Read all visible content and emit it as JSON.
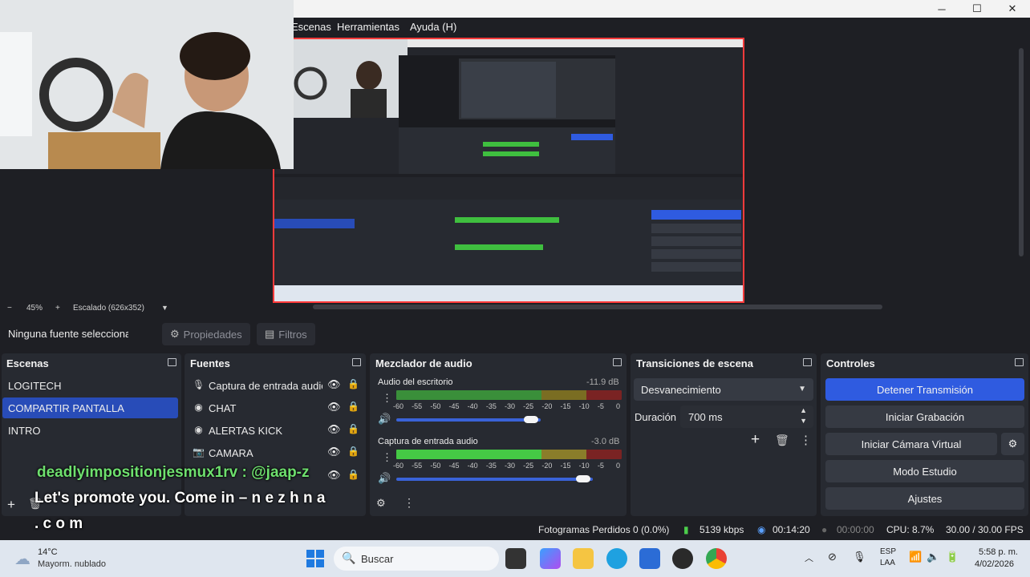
{
  "window": {
    "minimize": "─",
    "maximize": "☐",
    "close": "✕"
  },
  "menu": [
    "Escenas",
    "Herramientas",
    "Ayuda (H)"
  ],
  "zoom": {
    "minus": "−",
    "level": "45%",
    "plus": "+",
    "scaling": "Escalado (626x352)"
  },
  "source_toolbar": {
    "no_source": "Ninguna fuente seleccionad",
    "properties": "Propiedades",
    "filters": "Filtros"
  },
  "scenes": {
    "title": "Escenas",
    "items": [
      "LOGITECH",
      "COMPARTIR PANTALLA",
      "INTRO"
    ],
    "active_index": 1
  },
  "sources": {
    "title": "Fuentes",
    "items": [
      {
        "label": "Captura de entrada audio",
        "icon": "microphone-icon"
      },
      {
        "label": "CHAT",
        "icon": "browser-icon"
      },
      {
        "label": "ALERTAS KICK",
        "icon": "browser-icon"
      },
      {
        "label": "CAMARA",
        "icon": "camera-icon"
      }
    ]
  },
  "mixer": {
    "title": "Mezclador de audio",
    "channels": [
      {
        "name": "Audio del escritorio",
        "db": "-11.9 dB",
        "level": 0.87,
        "volume": 0.91
      },
      {
        "name": "Captura de entrada audio",
        "db": "-3.0 dB",
        "level": 0.92,
        "volume": 0.85
      }
    ],
    "scale": [
      "-60",
      "-55",
      "-50",
      "-45",
      "-40",
      "-35",
      "-30",
      "-25",
      "-20",
      "-15",
      "-10",
      "-5",
      "0"
    ]
  },
  "transitions": {
    "title": "Transiciones de escena",
    "selected": "Desvanecimiento",
    "duration_label": "Duración",
    "duration_value": "700 ms"
  },
  "controls": {
    "title": "Controles",
    "buttons": [
      "Detener Transmisión",
      "Iniciar Grabación",
      "Iniciar Cámara Virtual",
      "Modo Estudio",
      "Ajustes"
    ]
  },
  "status": {
    "dropped_frames": "Fotogramas Perdidos 0 (0.0%)",
    "bitrate": "5139 kbps",
    "stream_time": "00:14:20",
    "record_time": "00:00:00",
    "cpu": "CPU: 8.7%",
    "fps": "30.00 / 30.00 FPS"
  },
  "captions": {
    "line1": "deadlyimpositionjesmux1rv : @jaap-z",
    "line2": "Let's promote you. Come in – n e z h n a",
    "line3": ". c o m"
  },
  "taskbar": {
    "weather_temp": "14°C",
    "weather_desc": "Mayorm. nublado",
    "search": "Buscar",
    "lang1": "ESP",
    "lang2": "LAA",
    "time": "5:58 p. m.",
    "date": "4/02/2026"
  },
  "colors": {
    "accent": "#2f5be0",
    "selected_scene": "#284cb8",
    "meter_green": "#3fbf3f",
    "meter_yellow": "#c7b22d",
    "meter_red": "#c43a3a"
  }
}
